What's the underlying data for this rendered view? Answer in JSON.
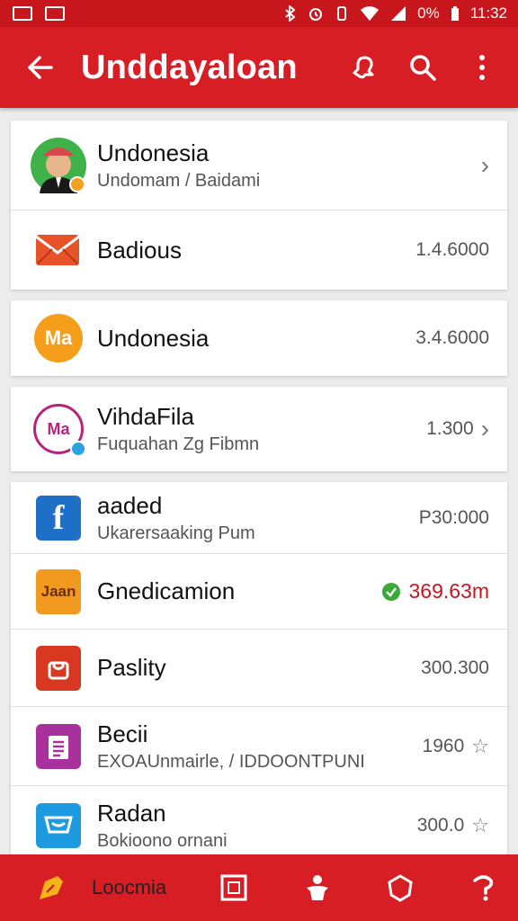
{
  "status_bar": {
    "battery_text": "0%",
    "time": "11:32"
  },
  "app_bar": {
    "title": "Unddayaloan"
  },
  "items": [
    {
      "title": "Undonesia",
      "subtitle": "Undomam / Baidami",
      "value": ""
    },
    {
      "title": "Badious",
      "subtitle": "",
      "value": "1.4.6000"
    },
    {
      "title": "Undonesia",
      "subtitle": "",
      "value": "3.4.6000"
    },
    {
      "title": "VihdaFila",
      "subtitle": "Fuquahan Zg Fibmn",
      "value": "1.300"
    },
    {
      "title": "aaded",
      "subtitle": "Ukarersaaking Pum",
      "value": "P30:000"
    },
    {
      "title": "Gnedicamion",
      "subtitle": "",
      "value": "369.63m"
    },
    {
      "title": "Paslity",
      "subtitle": "",
      "value": "300.300"
    },
    {
      "title": "Becii",
      "subtitle": "EXOAUnmairle, / IDDOONTPUNI",
      "value": "1960"
    },
    {
      "title": "Radan",
      "subtitle": "Bokioono ornani",
      "value": "300.0"
    }
  ],
  "avatars": {
    "badge_3": "Ma",
    "badge_4": "Ma",
    "app_5": "f",
    "app_6": "Jaan"
  },
  "bottom_bar": {
    "label": "Loocmia"
  },
  "colors": {
    "primary": "#d81e25",
    "status_bar": "#c8161d",
    "accent_green": "#3aa935",
    "value_red": "#c8161d"
  }
}
